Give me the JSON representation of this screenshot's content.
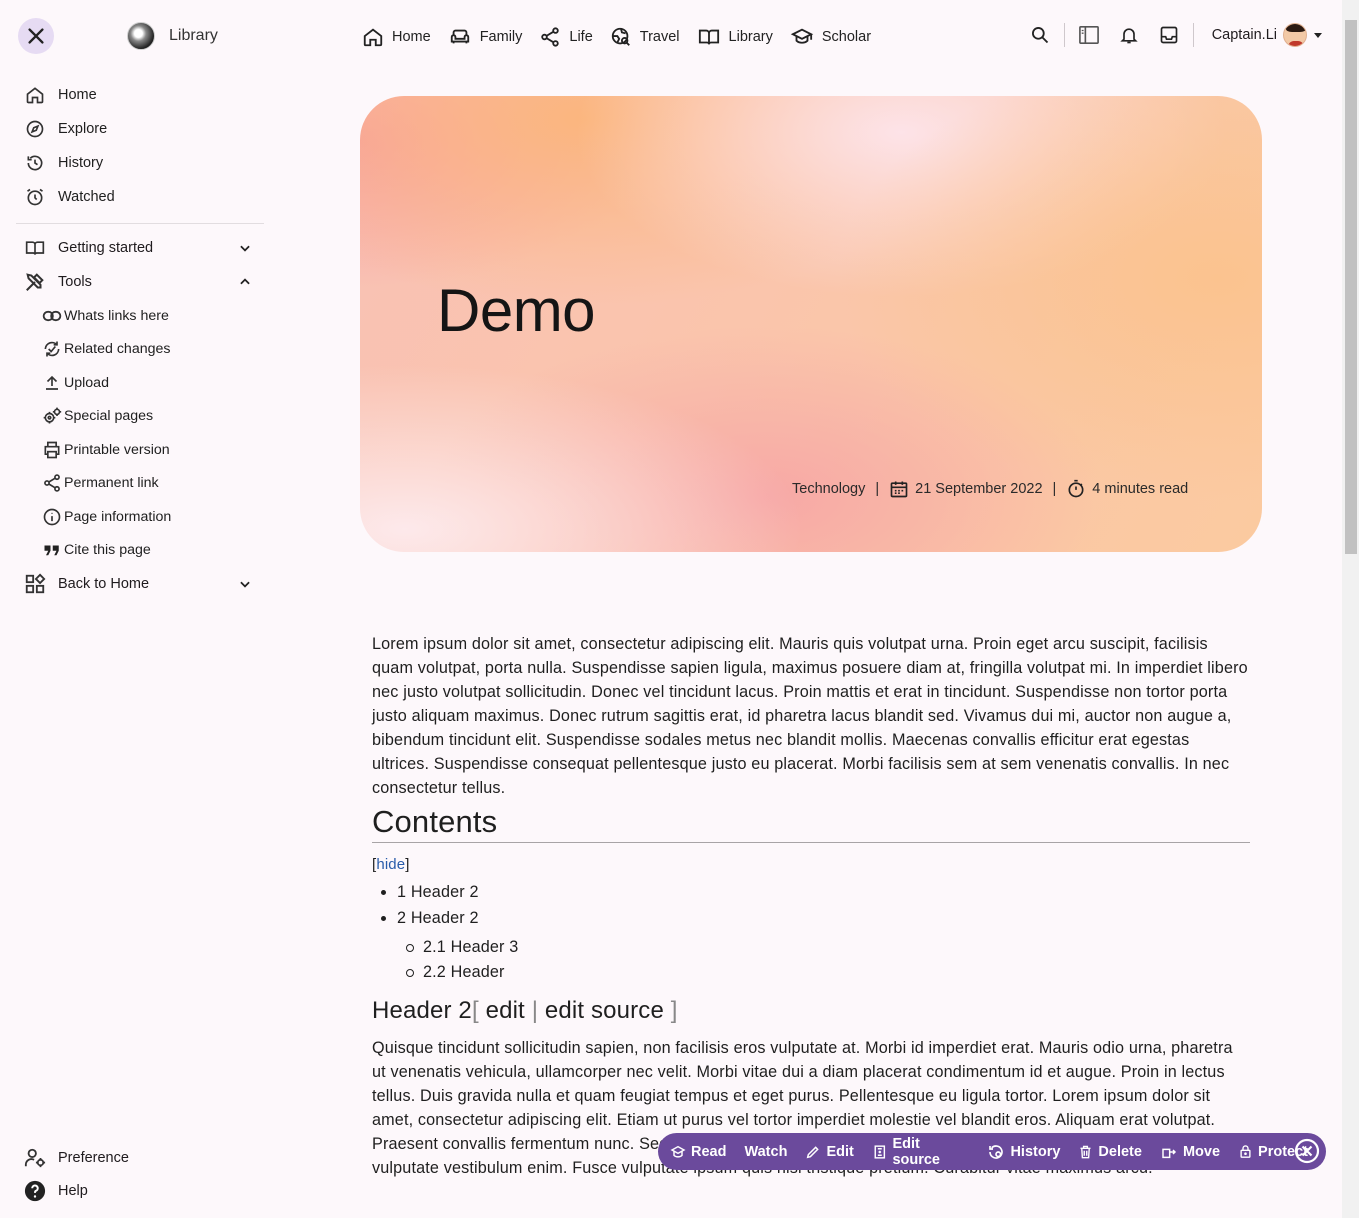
{
  "sidebar": {
    "brand": "Library",
    "nav": [
      {
        "label": "Home",
        "icon": "home-icon"
      },
      {
        "label": "Explore",
        "icon": "compass-icon"
      },
      {
        "label": "History",
        "icon": "history-icon"
      },
      {
        "label": "Watched",
        "icon": "alarm-icon"
      }
    ],
    "getting_started": "Getting started",
    "tools": {
      "label": "Tools",
      "items": [
        {
          "label": "Whats links here",
          "icon": "link-icon"
        },
        {
          "label": "Related changes",
          "icon": "sync-icon"
        },
        {
          "label": "Upload",
          "icon": "upload-icon"
        },
        {
          "label": "Special pages",
          "icon": "gears-icon"
        },
        {
          "label": "Printable version",
          "icon": "printer-icon"
        },
        {
          "label": "Permanent link",
          "icon": "share-icon"
        },
        {
          "label": "Page information",
          "icon": "info-icon"
        },
        {
          "label": "Cite this page",
          "icon": "quote-icon"
        }
      ]
    },
    "back_to_home": "Back to Home",
    "preference": "Preference",
    "help": "Help"
  },
  "topnav": [
    {
      "label": "Home",
      "icon": "home-icon"
    },
    {
      "label": "Family",
      "icon": "sofa-icon"
    },
    {
      "label": "Life",
      "icon": "share-icon"
    },
    {
      "label": "Travel",
      "icon": "globe-search-icon"
    },
    {
      "label": "Library",
      "icon": "book-icon"
    },
    {
      "label": "Scholar",
      "icon": "graduation-cap-icon"
    }
  ],
  "user": {
    "name": "Captain.Li"
  },
  "hero": {
    "title": "Demo",
    "category": "Technology",
    "date": "21 September 2022",
    "read_time": "4 minutes read"
  },
  "article": {
    "intro": "Lorem ipsum dolor sit amet, consectetur adipiscing elit. Mauris quis volutpat urna. Proin eget arcu suscipit, facilisis quam volutpat, porta nulla. Suspendisse sapien ligula, maximus posuere diam at, fringilla volutpat mi. In imperdiet libero nec justo volutpat sollicitudin. Donec vel tincidunt lacus. Proin mattis et erat in tincidunt. Suspendisse non tortor porta justo aliquam maximus. Donec rutrum sagittis erat, id pharetra lacus blandit sed. Vivamus dui mi, auctor non augue a, bibendum tincidunt elit. Suspendisse sodales metus nec blandit mollis. Maecenas convallis efficitur erat egestas ultrices. Suspendisse consequat pellentesque justo eu placerat. Morbi facilisis sem at sem venenatis convallis. In nec consectetur tellus.",
    "contents_title": "Contents",
    "hide_label": "hide",
    "toc": [
      {
        "num": "1",
        "label": "Header 2"
      },
      {
        "num": "2",
        "label": "Header 2"
      },
      {
        "num": "2.1",
        "label": "Header 3"
      },
      {
        "num": "2.2",
        "label": "Header"
      }
    ],
    "section_heading": "Header 2",
    "edit_label": "edit",
    "edit_source_label": "edit source",
    "section_text": "Quisque tincidunt sollicitudin sapien, non facilisis eros vulputate at. Morbi id imperdiet erat. Mauris odio urna, pharetra ut venenatis vehicula, ullamcorper nec velit. Morbi vitae dui a diam placerat condimentum id et augue. Proin in lectus tellus. Duis gravida nulla et quam feugiat tempus et eget purus. Pellentesque eu ligula tortor. Lorem ipsum dolor sit amet, consectetur adipiscing elit. Etiam ut purus vel tortor imperdiet molestie vel blandit eros. Aliquam erat volutpat. Praesent convallis fermentum nunc. Sed eu turpis a lectus commodo mollis. Donec eu nunc, imperdiet vitae justo a, vulputate vestibulum enim. Fusce vulputate ipsum quis nisi tristique pretium. Curabitur vitae maximus arcu."
  },
  "actionbar": {
    "items": [
      {
        "label": "Read",
        "icon": "read-icon"
      },
      {
        "label": "Watch",
        "icon": ""
      },
      {
        "label": "Edit",
        "icon": "pencil-icon"
      },
      {
        "label": "Edit source",
        "icon": "source-icon"
      },
      {
        "label": "History",
        "icon": "history-icon"
      },
      {
        "label": "Delete",
        "icon": "trash-icon"
      },
      {
        "label": "Move",
        "icon": "move-icon"
      },
      {
        "label": "Protect",
        "icon": "lock-icon"
      }
    ],
    "bg_color": "#6b4a9c"
  }
}
